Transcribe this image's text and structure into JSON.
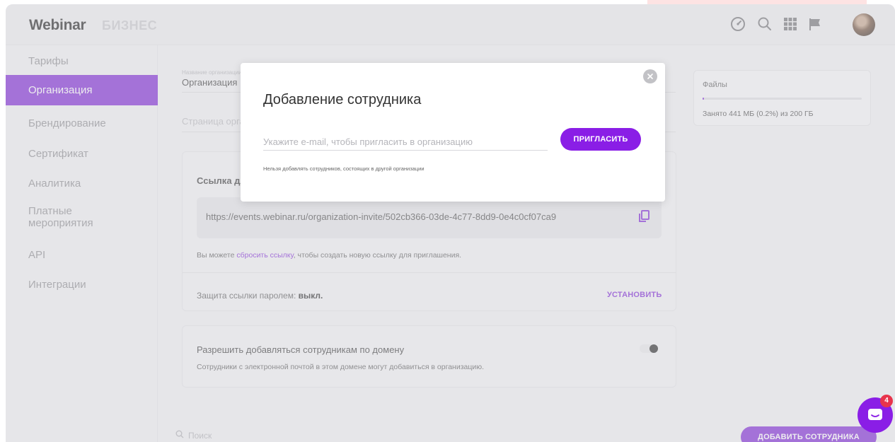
{
  "header": {
    "logo": "Webinar",
    "logo_sub": "БИЗНЕС",
    "icons": [
      "speedometer-icon",
      "search-icon",
      "apps-grid-icon",
      "flag-icon",
      "avatar"
    ]
  },
  "sidebar": {
    "items": [
      {
        "label": "Тарифы"
      },
      {
        "label": "Организация",
        "active": true
      },
      {
        "label": "Брендирование"
      },
      {
        "label": "Сертификат"
      },
      {
        "label": "Аналитика"
      },
      {
        "label": "Платные мероприятия"
      },
      {
        "label": "API"
      },
      {
        "label": "Интеграции"
      }
    ]
  },
  "org": {
    "name_label": "Название организации",
    "name_value": "Организация",
    "page_placeholder": "Страница организации"
  },
  "invite_card": {
    "title": "Ссылка для приглашения",
    "link": "https://events.webinar.ru/organization-invite/502cb366-03de-4c77-8dd9-0e4c0cf07ca9",
    "reset_prefix": "Вы можете ",
    "reset_link": "сбросить ссылку",
    "reset_suffix": ", чтобы создать новую ссылку для приглашения.",
    "password_label": "Защита ссылки паролем: ",
    "password_value": "выкл.",
    "set_button": "УСТАНОВИТЬ"
  },
  "domain_card": {
    "title": "Разрешить добавляться сотрудникам по домену",
    "description": "Сотрудники с электронной почтой в этом домене могут добавиться в организацию.",
    "toggle_on": false
  },
  "files": {
    "title": "Файлы",
    "used_text": "Занято 441 МБ (0.2%) из 200 ГБ",
    "used_fraction": 0.002
  },
  "bottom": {
    "search_placeholder": "Поиск",
    "add_employee_button": "ДОБАВИТЬ СОТРУДНИКА"
  },
  "modal": {
    "title": "Добавление сотрудника",
    "email_placeholder": "Укажите e-mail, чтобы пригласить в организацию",
    "email_value": "",
    "invite_button": "ПРИГЛАСИТЬ",
    "note": "Нельзя добавлять сотрудников, состоящих в другой организации"
  },
  "chat": {
    "badge_count": "4"
  },
  "colors": {
    "accent": "#7b1fd6",
    "badge": "#e8344b"
  }
}
